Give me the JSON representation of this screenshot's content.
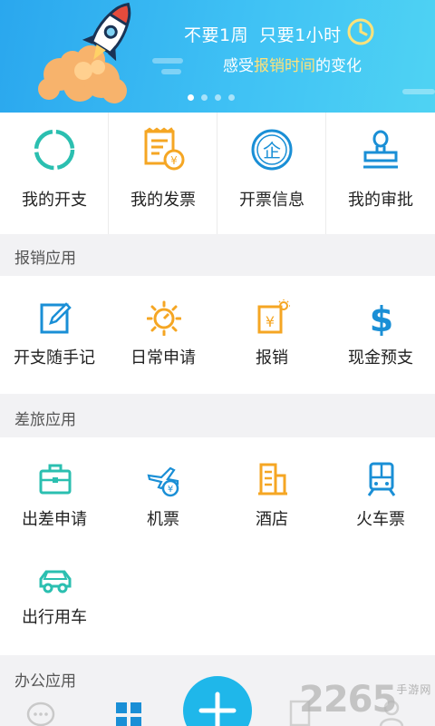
{
  "banner": {
    "line1_a": "不要1周",
    "line1_b": "只要1小时",
    "line2_pre": "感受",
    "line2_highlight": "报销时间",
    "line2_post": "的变化",
    "highlight_color": "#ffe27a",
    "page_indicator": {
      "count": 4,
      "active": 1
    }
  },
  "top_grid": [
    {
      "label": "我的开支",
      "icon": "ring-icon"
    },
    {
      "label": "我的发票",
      "icon": "invoice-icon"
    },
    {
      "label": "开票信息",
      "icon": "company-seal-icon"
    },
    {
      "label": "我的审批",
      "icon": "stamp-icon"
    }
  ],
  "sections": {
    "reimbursement": {
      "title": "报销应用",
      "items": [
        {
          "label": "开支随手记",
          "icon": "edit-note-icon"
        },
        {
          "label": "日常申请",
          "icon": "sun-clock-icon"
        },
        {
          "label": "报销",
          "icon": "yen-receipt-icon"
        },
        {
          "label": "现金预支",
          "icon": "dollar-icon"
        }
      ]
    },
    "travel": {
      "title": "差旅应用",
      "items": [
        {
          "label": "出差申请",
          "icon": "briefcase-icon"
        },
        {
          "label": "机票",
          "icon": "plane-yen-icon"
        },
        {
          "label": "酒店",
          "icon": "hotel-building-icon"
        },
        {
          "label": "火车票",
          "icon": "train-icon"
        },
        {
          "label": "出行用车",
          "icon": "car-icon"
        }
      ]
    },
    "office": {
      "title": "办公应用"
    }
  },
  "bottom_nav": {
    "items": [
      {
        "name": "message",
        "icon": "chat-bubble-icon"
      },
      {
        "name": "apps",
        "icon": "grid-icon"
      },
      {
        "name": "add",
        "icon": "plus-icon"
      },
      {
        "name": "docs",
        "icon": "document-icon"
      },
      {
        "name": "profile",
        "icon": "user-icon"
      }
    ],
    "fab_color": "#1fb7ea"
  },
  "watermark": {
    "text": "2265",
    "suffix": "手游网"
  },
  "colors": {
    "teal": "#2bbfb0",
    "orange": "#f5a623",
    "blue": "#1a8fd6",
    "banner": "#2aa7ee"
  }
}
